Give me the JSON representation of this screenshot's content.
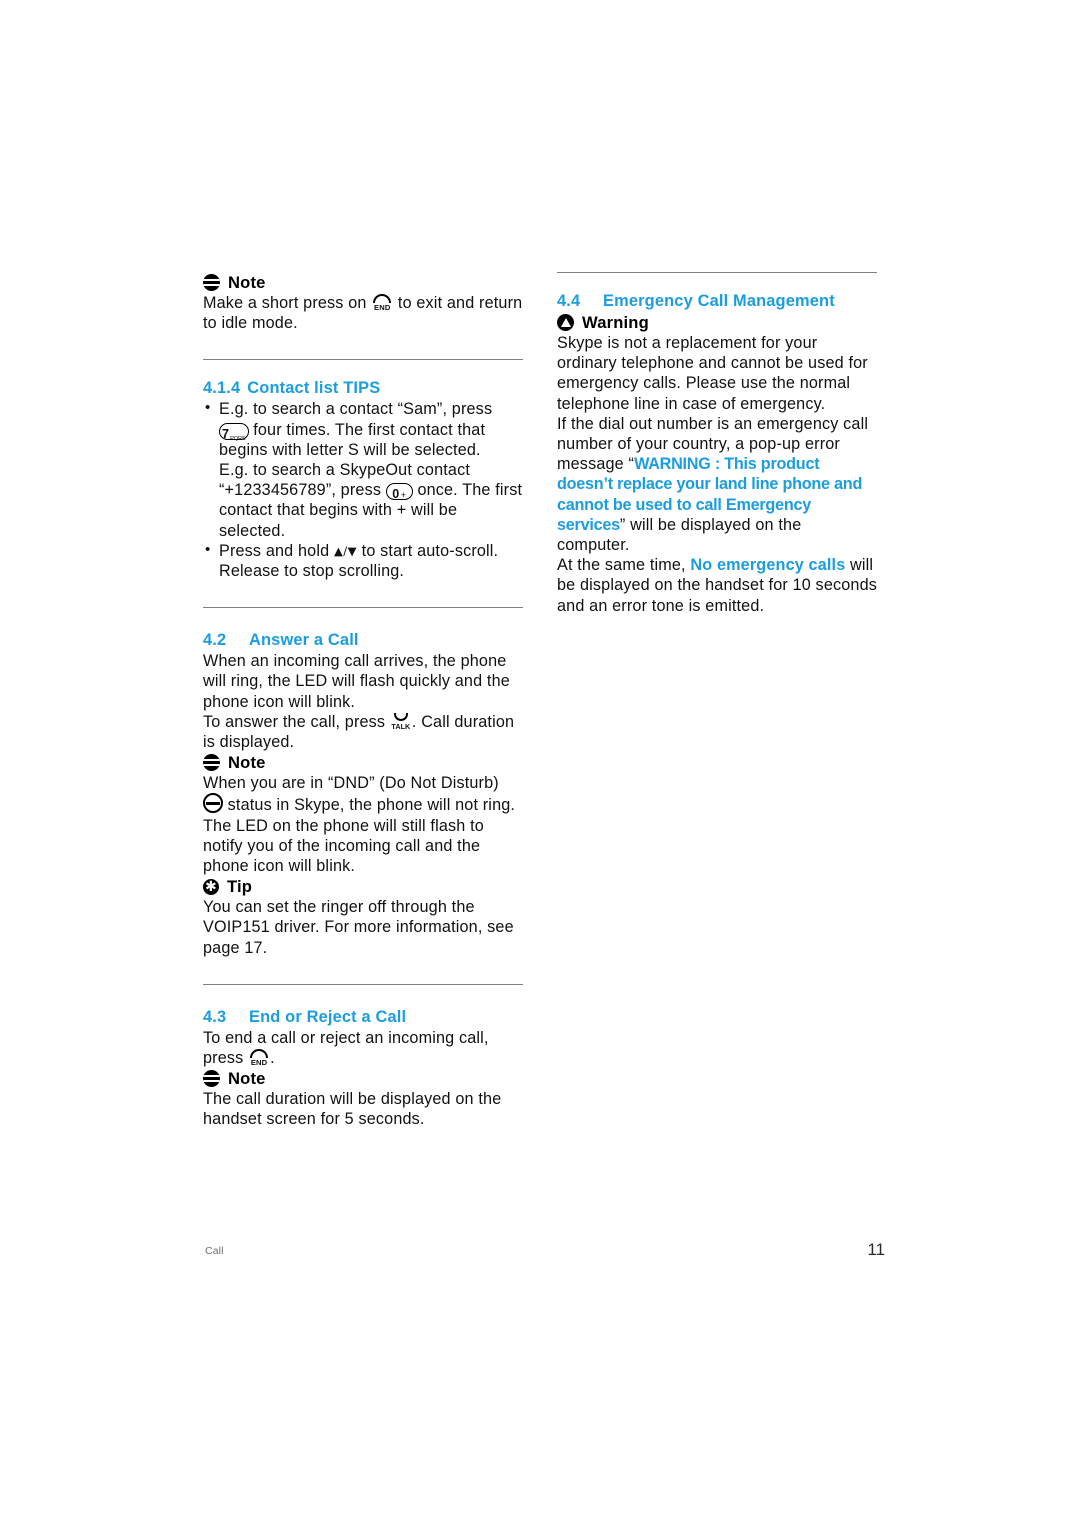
{
  "document": {
    "footer_left": "Call",
    "page_number": "11",
    "accent_color": "#1b9de0"
  },
  "left_column": {
    "note1": {
      "icon": "note-icon",
      "title": "Note",
      "text_before_icon": "Make a short press on",
      "key_icon": "end-key-icon",
      "key_label": "END",
      "text_after_icon": "to exit and return to idle mode."
    },
    "section_414": {
      "number": "4.1.4",
      "title": "Contact list TIPS",
      "bullet1": {
        "part1": "E.g. to search a contact “Sam”, press",
        "key": "7",
        "key_sub": "PQRS",
        "part2": "four times. The first contact that begins with letter S will be selected.",
        "part3": "E.g. to search a SkypeOut contact “+1233456789”, press",
        "key2": "0",
        "key2_sub": "+",
        "part4": "once. The first contact that begins with + will be selected."
      },
      "bullet2": {
        "part1": "Press and hold",
        "arrows": "▲/▼",
        "part2": "to start auto-scroll. Release to stop scrolling."
      }
    },
    "section_42": {
      "number": "4.2",
      "title": "Answer a Call",
      "para1": "When an incoming call arrives, the phone will ring, the LED will flash quickly and the phone icon will blink.",
      "para2_before": "To answer the call, press",
      "talk_key_label": "TALK",
      "para2_after": ". Call duration is displayed.",
      "note": {
        "icon": "note-icon",
        "title": "Note",
        "text_before_icon": "When you are in “DND” (Do Not Disturb)",
        "dnd_icon": "dnd-icon",
        "text_after_icon": "status in Skype, the phone will not ring. The LED on the phone will still flash to notify you of the incoming call and the phone icon will blink."
      },
      "tip": {
        "icon": "tip-icon",
        "title": "Tip",
        "text": "You can set the ringer off through the VOIP151 driver. For more information, see page 17."
      }
    },
    "section_43": {
      "number": "4.3",
      "title": "End or Reject a Call",
      "para_before": "To end a call or reject an incoming call, press",
      "key_label": "END",
      "para_after": ".",
      "note": {
        "icon": "note-icon",
        "title": "Note",
        "text": "The call duration will be displayed on the handset screen for 5 seconds."
      }
    }
  },
  "right_column": {
    "section_44": {
      "number": "4.4",
      "title": "Emergency Call Management",
      "warning": {
        "icon": "warning-icon",
        "title": "Warning"
      },
      "para1": "Skype is not a replacement for your ordinary telephone and cannot be used for emergency calls. Please use the normal telephone line in case of emergency.",
      "para2_intro": "If the dial out number is an emergency call number of your country,  a pop-up error message",
      "quote_open": "“",
      "popup_message": "WARNING : This product doesn’t replace your land line phone and cannot be used to call Emergency services",
      "quote_close": "”",
      "para2_tail": " will be displayed on the computer.",
      "para3_before": "At the same time,",
      "handset_message": "No emergency calls",
      "para3_after": "will be displayed on the handset for 10 seconds and an error tone is emitted."
    }
  }
}
